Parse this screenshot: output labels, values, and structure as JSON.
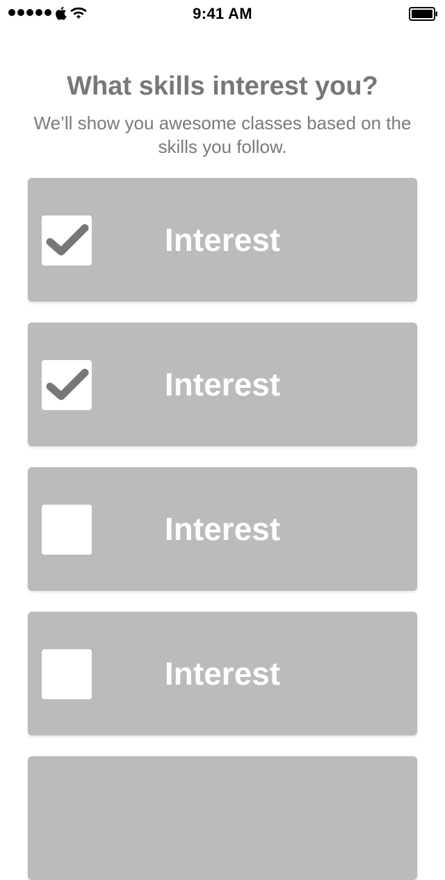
{
  "status_bar": {
    "time": "9:41 AM",
    "signal_bars": 5,
    "battery_level": 1.0
  },
  "header": {
    "title": "What skills interest you?",
    "subtitle": "We’ll show you awesome classes based on the skills you follow."
  },
  "interests": [
    {
      "label": "Interest",
      "checked": true
    },
    {
      "label": "Interest",
      "checked": true
    },
    {
      "label": "Interest",
      "checked": false
    },
    {
      "label": "Interest",
      "checked": false
    },
    {
      "label": "",
      "checked": false
    }
  ],
  "colors": {
    "card_background": "#bbbbbb",
    "title_text": "#777777",
    "checkmark": "#777777",
    "checkbox_background": "#ffffff"
  },
  "icons": {
    "carrier": "apple-icon",
    "wifi": "wifi-icon",
    "battery": "battery-icon",
    "checkmark": "checkmark-icon"
  }
}
